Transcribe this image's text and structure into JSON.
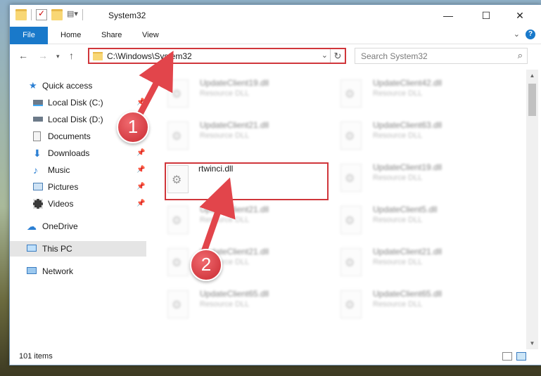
{
  "window": {
    "title": "System32"
  },
  "ribbon": {
    "tabs": [
      "File",
      "Home",
      "Share",
      "View"
    ]
  },
  "address": {
    "path": "C:\\Windows\\System32"
  },
  "search": {
    "placeholder": "Search System32"
  },
  "nav": {
    "items": [
      {
        "label": "Quick access",
        "icon": "star-icon",
        "pinned": false
      },
      {
        "label": "Local Disk (C:)",
        "icon": "drive-icon",
        "pinned": true
      },
      {
        "label": "Local Disk (D:)",
        "icon": "drive-icon",
        "pinned": true
      },
      {
        "label": "Documents",
        "icon": "documents-icon",
        "pinned": true
      },
      {
        "label": "Downloads",
        "icon": "download-icon",
        "pinned": true
      },
      {
        "label": "Music",
        "icon": "music-icon",
        "pinned": true
      },
      {
        "label": "Pictures",
        "icon": "pictures-icon",
        "pinned": true
      },
      {
        "label": "Videos",
        "icon": "videos-icon",
        "pinned": true
      },
      {
        "label": "OneDrive",
        "icon": "cloud-icon",
        "pinned": false
      },
      {
        "label": "This PC",
        "icon": "computer-icon",
        "pinned": false,
        "selected": true
      },
      {
        "label": "Network",
        "icon": "network-icon",
        "pinned": false
      }
    ]
  },
  "files": {
    "left": [
      {
        "name": "UpdateClient19.dll",
        "type": "Resource DLL"
      },
      {
        "name": "UpdateClient21.dll",
        "type": "Resource DLL"
      },
      {
        "name": "rtwinci.dll",
        "type": ""
      },
      {
        "name": "UpdateClient21.dll",
        "type": "Resource DLL"
      },
      {
        "name": "UpdateClient21.dll",
        "type": "Resource DLL"
      },
      {
        "name": "UpdateClient65.dll",
        "type": "Resource DLL"
      }
    ],
    "right": [
      {
        "name": "UpdateClient42.dll",
        "type": "Resource DLL"
      },
      {
        "name": "UpdateClient63.dll",
        "type": "Resource DLL"
      },
      {
        "name": "UpdateClient19.dll",
        "type": "Resource DLL"
      },
      {
        "name": "UpdateClient5.dll",
        "type": "Resource DLL"
      },
      {
        "name": "UpdateClient21.dll",
        "type": "Resource DLL"
      },
      {
        "name": "UpdateClient65.dll",
        "type": "Resource DLL"
      }
    ]
  },
  "status": {
    "count": "101 items"
  },
  "callouts": {
    "one": "1",
    "two": "2"
  },
  "colors": {
    "accent": "#1979ca",
    "highlight": "#d0363b"
  }
}
